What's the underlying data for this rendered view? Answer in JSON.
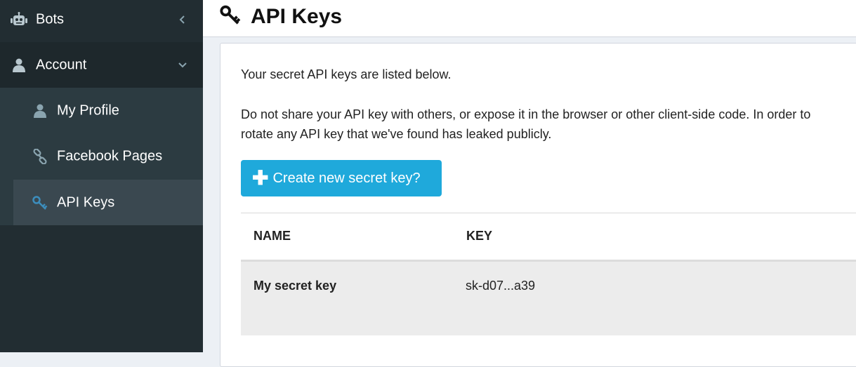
{
  "sidebar": {
    "items": [
      {
        "label": "Bots",
        "icon": "robot-icon",
        "chevron": "left"
      },
      {
        "label": "Account",
        "icon": "user-icon",
        "chevron": "down"
      }
    ],
    "submenu": [
      {
        "label": "My Profile",
        "icon": "user-icon"
      },
      {
        "label": "Facebook Pages",
        "icon": "link-icon"
      },
      {
        "label": "API Keys",
        "icon": "key-icon",
        "active": true
      }
    ]
  },
  "header": {
    "title": "API Keys",
    "icon": "key-icon"
  },
  "main": {
    "intro": "Your secret API keys are listed below.",
    "warning_line1": "Do not share your API key with others, or expose it in the browser or other client-side code. In order to",
    "warning_line2": "rotate any API key that we've found has leaked publicly.",
    "create_button": "Create new secret key?",
    "table": {
      "columns": [
        "NAME",
        "KEY"
      ],
      "rows": [
        {
          "name": "My secret key",
          "key": "sk-d07...a39"
        }
      ]
    }
  },
  "colors": {
    "sidebar_bg": "#222d32",
    "submenu_bg": "#2c3b41",
    "active_bg": "#3a4850",
    "accent": "#1fa9db",
    "key_icon_active": "#3c8dbc"
  }
}
